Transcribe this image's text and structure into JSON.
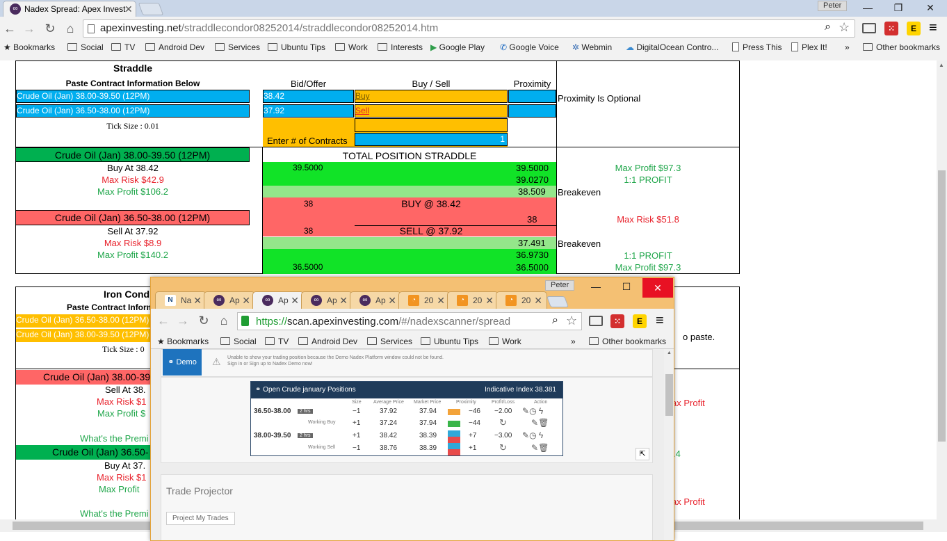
{
  "browser": {
    "tab_title": "Nadex Spread: Apex Invest",
    "user": "Peter",
    "url_host": "apexinvesting.net",
    "url_path": "/straddlecondor08252014/straddlecondor08252014.htm",
    "bookmarks": [
      "Bookmarks",
      "Social",
      "TV",
      "Android Dev",
      "Services",
      "Ubuntu Tips",
      "Work",
      "Interests",
      "Google Play",
      "Google Voice",
      "Webmin",
      "DigitalOcean Contro...",
      "Press This",
      "Plex It!"
    ],
    "overflow": "»",
    "other_bookmarks": "Other bookmarks"
  },
  "straddle": {
    "title": "Straddle",
    "paste_label": "Paste Contract Information Below",
    "bid_offer_label": "Bid/Offer",
    "buy_sell_label": "Buy / Sell",
    "proximity_label": "Proximity",
    "contract1": "Crude Oil (Jan) 38.00-39.50 (12PM)",
    "contract2": "Crude Oil (Jan) 36.50-38.00 (12PM)",
    "bid1": "38.42",
    "bid2": "37.92",
    "buy_link": "Buy",
    "sell_link": "Sell",
    "proximity_note": "Proximity Is Optional",
    "tick_size": "Tick Size :  0.01",
    "enter_contracts": "Enter # of Contracts",
    "contracts_value": "1",
    "leg1_header": "Crude Oil (Jan) 38.00-39.50 (12PM)",
    "leg1_buy_at": "Buy At  38.42",
    "leg1_max_risk": "Max Risk  $42.9",
    "leg1_max_profit": "Max Profit  $106.2",
    "leg2_header": "Crude Oil (Jan) 36.50-38.00 (12PM)",
    "leg2_sell_at": "Sell At  37.92",
    "leg2_max_risk": "Max Risk  $8.9",
    "leg2_max_profit": "Max Profit  $140.2",
    "total_title": "TOTAL POSITION STRADDLE",
    "top_left": "39.5000",
    "top_right": "39.5000",
    "r2": "39.0270",
    "r3": "38.509",
    "breakeven": "Breakeven",
    "buy_left": "38",
    "buy_at_label": "BUY @  38.42",
    "buy_right": "38",
    "sell_left": "38",
    "sell_at_label": "SELL @  37.92",
    "r7": "37.491",
    "r8": "36.9730",
    "bot_left": "36.5000",
    "bot_right": "36.5000",
    "max_profit_top": "Max Profit  $97.3",
    "one_to_one": "1:1 PROFIT",
    "max_risk_total": "Max Risk  $51.8",
    "max_profit_bottom": "Max Profit  $97.3"
  },
  "condor": {
    "title": "Iron Cond",
    "paste_label": "Paste Contract Inform",
    "contract1": "Crude Oil (Jan) 36.50-38.00 (12PM)",
    "contract2": "Crude Oil (Jan) 38.00-39.50 (12PM)",
    "tick_size": "Tick Size :  0",
    "paste_hint": "o paste.",
    "leg1_header": "Crude Oil (Jan) 38.00-39",
    "leg1_sell_at": "Sell At  38.",
    "leg1_max_risk": "Max Risk  $1",
    "leg1_max_profit": "Max Profit  $",
    "premium_q": "What's the Premi",
    "leg2_header": "Crude Oil (Jan) 36.50-",
    "leg2_buy_at": "Buy At  37.",
    "leg2_max_risk": "Max Risk  $1",
    "leg2_max_profit": "Max Profit  ",
    "premium_q2": "What's the Premi",
    "right_max_profit1": "ax Profit",
    "right_val": ".4",
    "right_max_profit2": "ax Profit"
  },
  "popup": {
    "user": "Peter",
    "tabs": [
      "Na",
      "Ap",
      "Ap",
      "Ap",
      "Ap",
      "20",
      "20",
      "20"
    ],
    "url_scheme": "https://",
    "url_host": "scan.apexinvesting.com",
    "url_path": "/#/nadexscanner/spread",
    "bookmarks": [
      "Bookmarks",
      "Social",
      "TV",
      "Android Dev",
      "Services",
      "Ubuntu Tips",
      "Work"
    ],
    "overflow": "»",
    "other_bookmarks": "Other bookmarks",
    "demo_label": "Demo",
    "warning_line1": "Unable to show your trading position because the Demo Nadex Platform window could not be found.",
    "warning_line2": "Sign in or Sign up to Nadex Demo now!",
    "positions_title": "Open Crude january Positions",
    "indicative": "Indicative Index 38.381",
    "cols": [
      "Size",
      "Average Price",
      "Market Price",
      "Proximity",
      "Profit/Loss",
      "Action"
    ],
    "rows": [
      {
        "name": "36.50-38.00",
        "badge": "2 hrs",
        "size": "−1",
        "avg": "37.92",
        "mkt": "37.94",
        "prox": "−46",
        "pl": "−2.00"
      },
      {
        "name": "Working Buy",
        "badge": "",
        "size": "+1",
        "avg": "37.24",
        "mkt": "37.94",
        "prox": "−44",
        "pl": ""
      },
      {
        "name": "38.00-39.50",
        "badge": "2 hrs",
        "size": "+1",
        "avg": "38.42",
        "mkt": "38.39",
        "prox": "+7",
        "pl": "−3.00"
      },
      {
        "name": "Working Sell",
        "badge": "",
        "size": "−1",
        "avg": "38.76",
        "mkt": "38.39",
        "prox": "+1",
        "pl": ""
      }
    ],
    "trade_projector": "Trade Projector",
    "project_btn": "Project My Trades"
  },
  "colors": {
    "cyan": "#00aeef",
    "orange": "#ffbf00",
    "green": "#11e327",
    "red": "#ff6666",
    "dark_green": "#00b050"
  }
}
